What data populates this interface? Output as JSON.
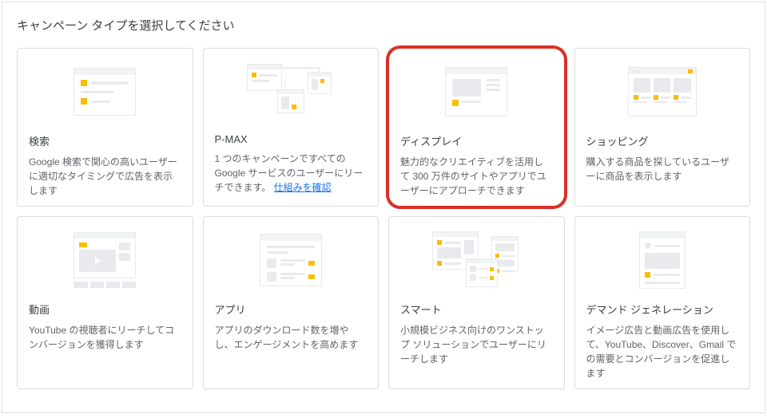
{
  "page_title": "キャンペーン タイプを選択してください",
  "cards": [
    {
      "id": "search",
      "title": "検索",
      "description": "Google 検索で関心の高いユーザーに適切なタイミングで広告を表示します"
    },
    {
      "id": "pmax",
      "title": "P-MAX",
      "description_prefix": "1 つのキャンペーンですべての Google サービスのユーザーにリーチできます。",
      "link_text": "仕組みを確認"
    },
    {
      "id": "display",
      "title": "ディスプレイ",
      "description": "魅力的なクリエイティブを活用して 300 万件のサイトやアプリでユーザーにアプローチできます",
      "highlighted": true
    },
    {
      "id": "shopping",
      "title": "ショッピング",
      "description": "購入する商品を探しているユーザーに商品を表示します"
    },
    {
      "id": "video",
      "title": "動画",
      "description": "YouTube の視聴者にリーチしてコンバージョンを獲得します"
    },
    {
      "id": "app",
      "title": "アプリ",
      "description": "アプリのダウンロード数を増やし、エンゲージメントを高めます"
    },
    {
      "id": "smart",
      "title": "スマート",
      "description": "小規模ビジネス向けのワンストップ ソリューションでユーザーにリーチします"
    },
    {
      "id": "demand",
      "title": "デマンド ジェネレーション",
      "description": "イメージ広告と動画広告を使用して、YouTube、Discover、Gmail での需要とコンバージョンを促進します"
    }
  ]
}
